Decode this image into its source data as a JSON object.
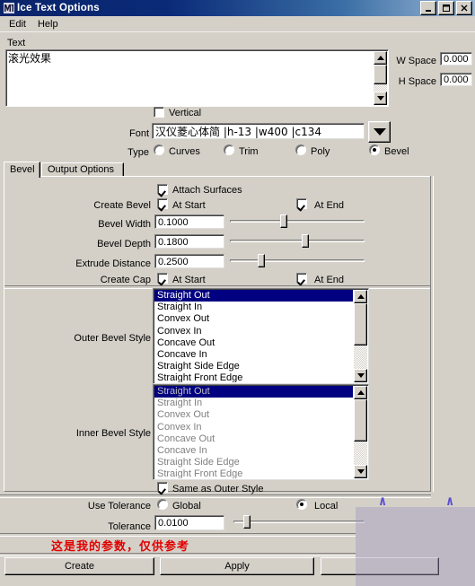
{
  "window": {
    "title": "Ice Text Options",
    "icon": "app-icon",
    "buttons": {
      "minimize": "_",
      "maximize": "□",
      "close": "✕"
    }
  },
  "menubar": {
    "items": [
      "Edit",
      "Help"
    ]
  },
  "text_section": {
    "label": "Text",
    "value": "滚光效果",
    "w_space": {
      "label": "W Space",
      "value": "0.000"
    },
    "h_space": {
      "label": "H Space",
      "value": "0.000"
    },
    "vertical": {
      "label": "Vertical",
      "checked": false
    },
    "font": {
      "label": "Font",
      "value": "汉仪菱心体简 |h-13 |w400 |c134"
    },
    "type": {
      "label": "Type",
      "options": [
        "Curves",
        "Trim",
        "Poly",
        "Bevel"
      ],
      "selected": "Bevel"
    }
  },
  "tabs": {
    "items": [
      "Bevel",
      "Output Options"
    ],
    "active": "Bevel"
  },
  "bevel": {
    "attach_surfaces": {
      "label": "Attach Surfaces",
      "checked": true
    },
    "create_bevel": {
      "label": "Create Bevel",
      "at_start": "At Start",
      "at_end": "At End",
      "start_checked": true,
      "end_checked": true
    },
    "bevel_width": {
      "label": "Bevel Width",
      "value": "0.1000",
      "slider_pct": 40
    },
    "bevel_depth": {
      "label": "Bevel Depth",
      "value": "0.1800",
      "slider_pct": 56
    },
    "extrude_distance": {
      "label": "Extrude Distance",
      "value": "0.2500",
      "slider_pct": 23
    },
    "create_cap": {
      "label": "Create Cap",
      "at_start": "At Start",
      "at_end": "At End",
      "start_checked": true,
      "end_checked": true
    },
    "outer_bevel_style": {
      "label": "Outer Bevel Style",
      "items": [
        "Straight Out",
        "Straight In",
        "Convex Out",
        "Convex In",
        "Concave Out",
        "Concave In",
        "Straight Side Edge",
        "Straight Front Edge"
      ],
      "selected": "Straight Out",
      "disabled": false
    },
    "inner_bevel_style": {
      "label": "Inner Bevel Style",
      "items": [
        "Straight Out",
        "Straight In",
        "Convex Out",
        "Convex In",
        "Concave Out",
        "Concave In",
        "Straight Side Edge",
        "Straight Front Edge"
      ],
      "selected": "Straight Out",
      "disabled": true
    },
    "same_as_outer": {
      "label": "Same as Outer Style",
      "checked": true
    }
  },
  "tolerance_section": {
    "use_tolerance": {
      "label": "Use Tolerance",
      "options": [
        "Global",
        "Local"
      ],
      "selected": "Local"
    },
    "tolerance": {
      "label": "Tolerance",
      "value": "0.0100",
      "slider_pct": 10
    }
  },
  "annotation": {
    "red_note": "这是我的参数，仅供参考"
  },
  "footer": {
    "buttons": [
      "Create",
      "Apply",
      ""
    ]
  },
  "colors": {
    "face": "#d4d0c8",
    "title_start": "#0a246a",
    "title_end": "#9db9d6",
    "selection": "#000080",
    "annotation_red": "#e10000",
    "overlay_purple": "#a096be",
    "caret_purple": "#5b4fcf"
  }
}
